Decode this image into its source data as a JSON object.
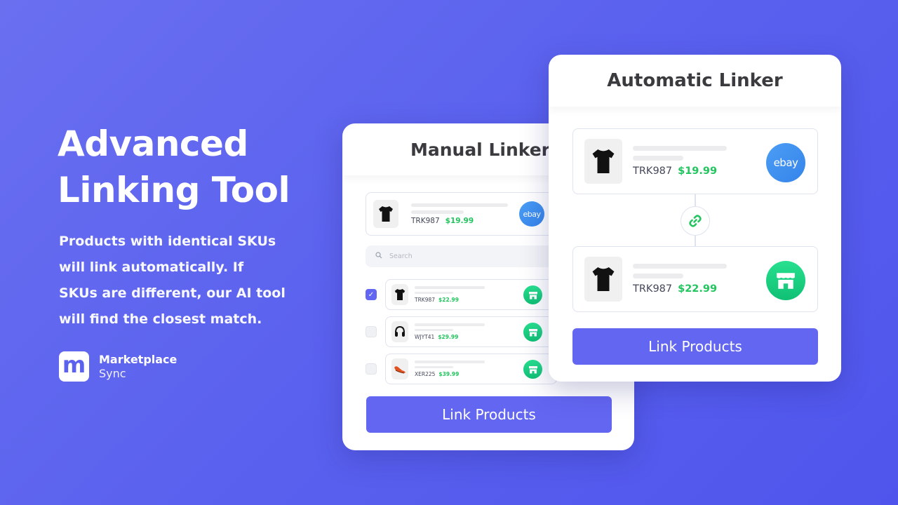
{
  "hero": {
    "title_line1": "Advanced",
    "title_line2": "Linking Tool",
    "desc_lines": [
      "Products with identical SKUs",
      "will link automatically. If",
      "SKUs are different, our AI tool",
      "will find the closest match."
    ]
  },
  "brand": {
    "logo_letter": "m",
    "name": "Marketplace",
    "sub": "Sync"
  },
  "manual": {
    "title": "Manual Linker",
    "top_item": {
      "sku": "TRK987",
      "price": "$19.99",
      "marketplace": "ebay",
      "image": "black-tshirt"
    },
    "search": {
      "placeholder": "Search",
      "icon": "search-icon"
    },
    "items": [
      {
        "checked": true,
        "sku": "TRK987",
        "price": "$22.99",
        "image": "black-tshirt",
        "store_icon": "store-icon"
      },
      {
        "checked": false,
        "sku": "WJYT41",
        "price": "$29.99",
        "image": "headphones",
        "store_icon": "store-icon"
      },
      {
        "checked": false,
        "sku": "XER225",
        "price": "$39.99",
        "image": "sneaker",
        "store_icon": "store-icon"
      }
    ],
    "button": "Link Products"
  },
  "auto": {
    "title": "Automatic Linker",
    "source": {
      "sku": "TRK987",
      "price": "$19.99",
      "marketplace": "ebay",
      "image": "black-tshirt"
    },
    "link_icon": "link-icon",
    "target": {
      "sku": "TRK987",
      "price": "$22.99",
      "image": "black-tshirt",
      "store_icon": "store-icon"
    },
    "button": "Link Products"
  },
  "colors": {
    "background": "#5b62ee",
    "accent": "#6366f1",
    "price_green": "#22c55e",
    "ebay_blue": "#3d8ff0",
    "store_green": "#10c074"
  }
}
